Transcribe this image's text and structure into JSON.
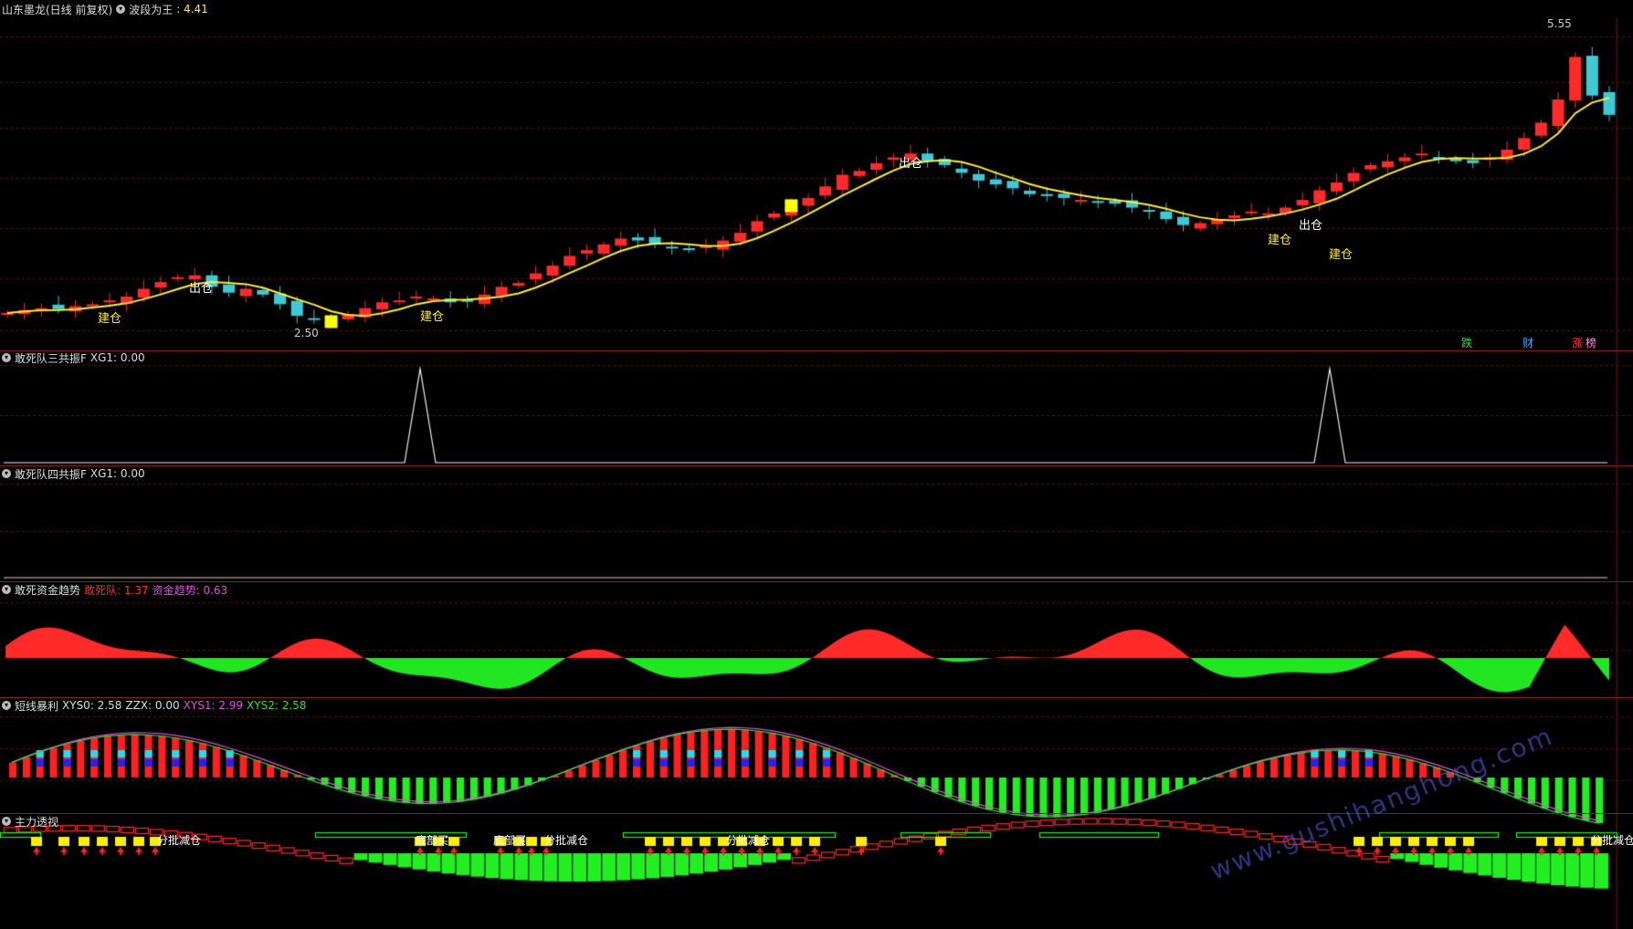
{
  "main": {
    "stock_title": "山东墨龙(日线 前复权)",
    "indicator_name": "波段为王",
    "indicator_value": ": 4.41",
    "price_high_label": "5.55",
    "price_low_label": "2.50",
    "signals": [
      {
        "text": "出仓",
        "color": "#ffffff"
      },
      {
        "text": "建仓",
        "color": "#ffff00"
      },
      {
        "text": "建仓",
        "color": "#ffff00"
      },
      {
        "text": "出仓",
        "color": "#ffffff"
      },
      {
        "text": "建仓",
        "color": "#ffff00"
      },
      {
        "text": "出仓",
        "color": "#ffffff"
      },
      {
        "text": "建仓",
        "color": "#ffff00"
      }
    ],
    "badges": [
      {
        "text": "跌",
        "color": "#33dd33"
      },
      {
        "text": "财",
        "color": "#33aaff"
      },
      {
        "text": "涨",
        "color": "#ff3333"
      },
      {
        "text": "榜",
        "color": "#ff88cc"
      }
    ],
    "colors": {
      "up": "#ff2a2a",
      "down": "#3ec9d6",
      "ma": "#ffee33",
      "mark": "#ffff00"
    }
  },
  "panel1": {
    "title": "敢死队三共振F",
    "stat": "XG1: 0.00",
    "spikes_at_bar": [
      49,
      159
    ]
  },
  "panel2": {
    "title": "敢死队四共振F",
    "stat": "XG1: 0.00"
  },
  "panel3": {
    "title": "敢死资金趋势",
    "label_a": "敢死队: 1.37",
    "label_b": "资金趋势: 0.63",
    "colors": {
      "a": "#ff2a2a",
      "b": "#e04ed8"
    }
  },
  "panel4": {
    "title": "短线暴利",
    "s1": "XYS0: 2.58",
    "s2": "ZZX: 0.00",
    "s3": "XYS1: 2.99",
    "s4": "XYS2: 2.58",
    "colors": {
      "s1": "#dddddd",
      "s2": "#dddddd",
      "s3": "#e04ed8",
      "s4": "#33dd33"
    }
  },
  "panel5": {
    "title": "主力透视",
    "labels": [
      "分批减仓",
      "底部买",
      "底部买",
      "分批减仓",
      "分批减仓",
      "分批减仓"
    ]
  },
  "watermark": "www.gushihanghong.com",
  "chart_data": {
    "type": "candlestick",
    "title": "山东墨龙(日线 前复权)",
    "ylim": [
      2.3,
      5.7
    ],
    "annotated_high": 5.55,
    "annotated_low": 2.5,
    "last_ma_value": 4.41,
    "series_closes": [
      2.65,
      2.68,
      2.7,
      2.69,
      2.72,
      2.74,
      2.78,
      2.82,
      2.9,
      2.97,
      3.02,
      3.04,
      2.92,
      2.86,
      2.9,
      2.84,
      2.74,
      2.62,
      2.58,
      2.56,
      2.64,
      2.7,
      2.76,
      2.78,
      2.82,
      2.8,
      2.76,
      2.78,
      2.84,
      2.92,
      2.96,
      3.06,
      3.14,
      3.24,
      3.3,
      3.36,
      3.42,
      3.4,
      3.36,
      3.32,
      3.3,
      3.34,
      3.4,
      3.48,
      3.6,
      3.68,
      3.76,
      3.84,
      3.96,
      4.08,
      4.12,
      4.2,
      4.26,
      4.3,
      4.22,
      4.18,
      4.1,
      4.02,
      3.98,
      3.94,
      3.88,
      3.86,
      3.84,
      3.82,
      3.8,
      3.78,
      3.74,
      3.7,
      3.62,
      3.56,
      3.58,
      3.62,
      3.66,
      3.7,
      3.68,
      3.74,
      3.82,
      3.92,
      4.0,
      4.1,
      4.18,
      4.22,
      4.26,
      4.3,
      4.26,
      4.22,
      4.2,
      4.26,
      4.34,
      4.46,
      4.62,
      4.86,
      5.3,
      4.9,
      4.7
    ]
  }
}
